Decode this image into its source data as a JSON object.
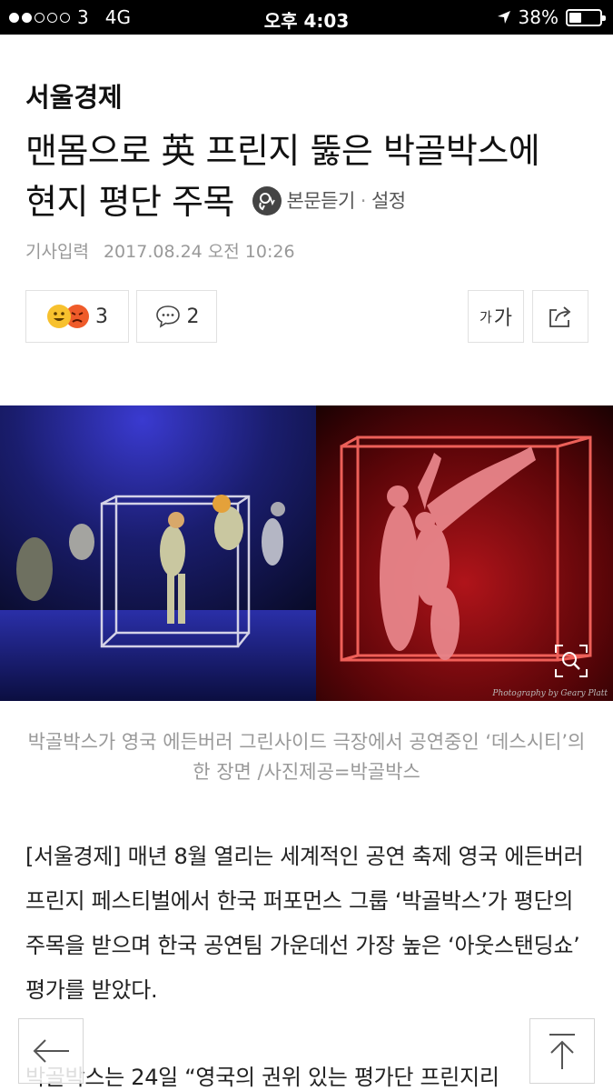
{
  "status_bar": {
    "carrier": "3",
    "network": "4G",
    "time": "오후 4:03",
    "battery": "38%"
  },
  "article": {
    "section": "서울경제",
    "headline_line1": "맨몸으로 英 프린지 뚫은 박골박스에",
    "headline_line2": "현지 평단 주목",
    "listen_label": "본문듣기",
    "settings_label": "설정",
    "date_label": "기사입력",
    "date_value": "2017.08.24 오전 10:26",
    "reaction_count": "3",
    "comment_count": "2",
    "font_small": "가",
    "font_large": "가",
    "photo_credit": "Photography by Geary Platt",
    "caption": "박골박스가 영국 에든버러 그린사이드 극장에서 공연중인 ‘데스시티’의 한 장면 /사진제공=박골박스",
    "paragraphs": [
      "[서울경제] 매년 8월 열리는 세계적인 공연 축제 영국 에든버러 프린지 페스티벌에서 한국 퍼포먼스 그룹 ‘박골박스’가 평단의 주목을 받으며 한국 공연팀 가운데선 가장 높은 ‘아웃스탠딩쇼’ 평가를 받았다.",
      "박골박스는 24일 “영국의 권위 있는 평가단 프린지리"
    ]
  },
  "colors": {
    "accent_text": "#111111",
    "muted_text": "#999999",
    "photo_left_bg": "#141a5a",
    "photo_right_bg": "#c0181f"
  }
}
